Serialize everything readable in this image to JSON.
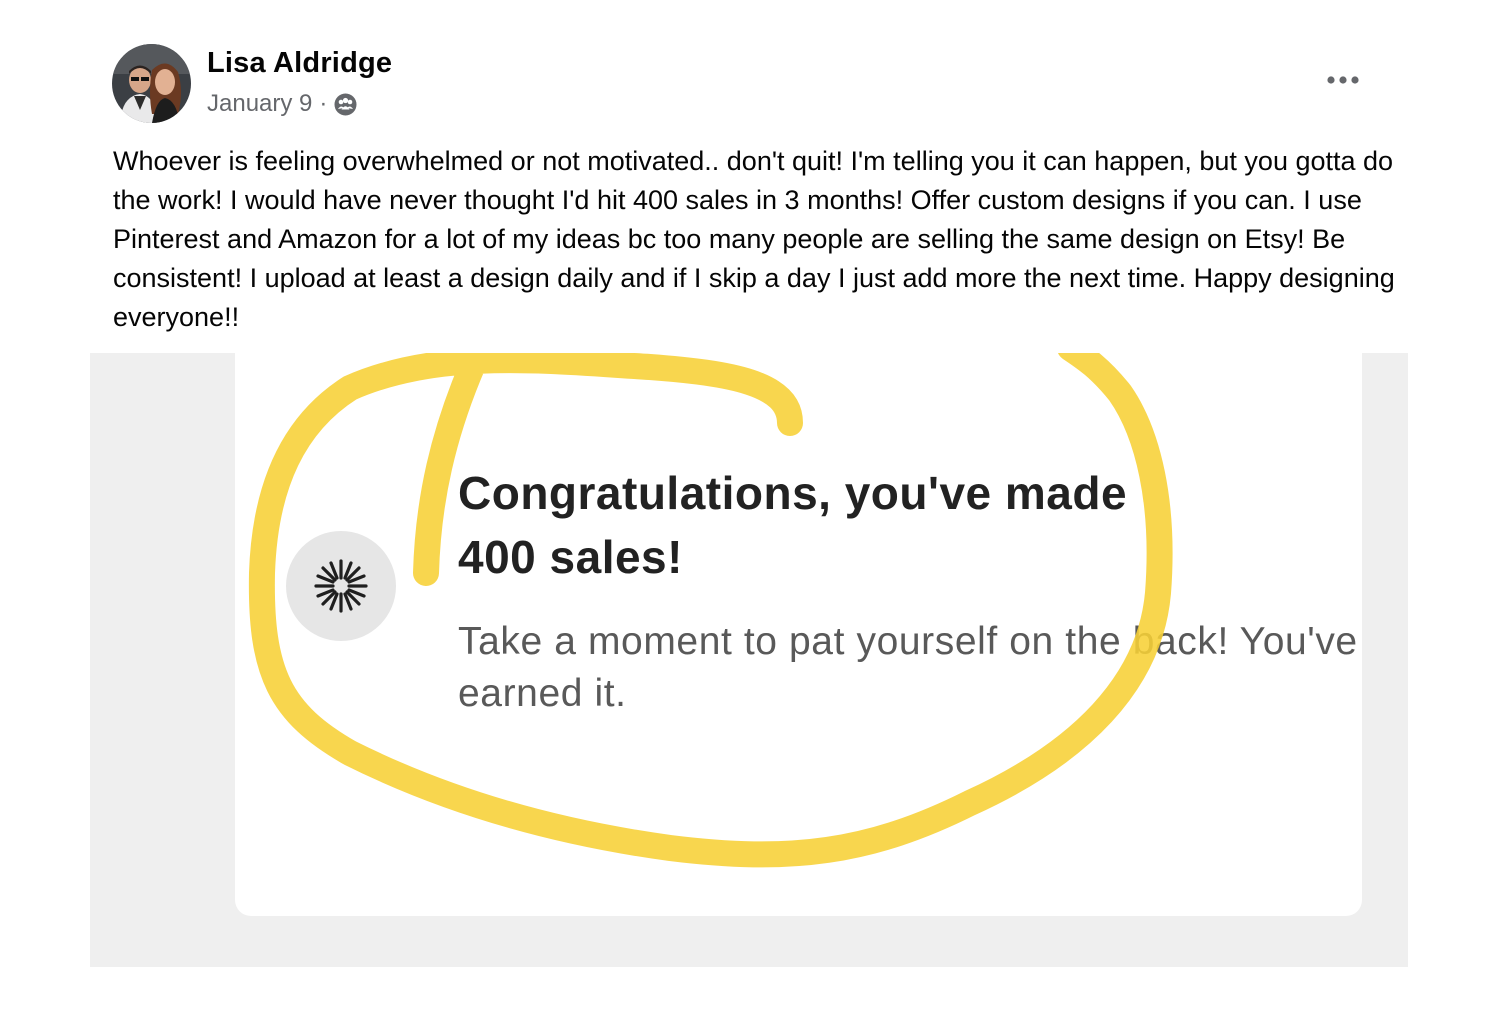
{
  "post": {
    "author": "Lisa Aldridge",
    "date": "January 9",
    "separator": "·",
    "audience_icon": "group-audience-icon",
    "more_icon": "more-options-icon",
    "text": "Whoever is feeling overwhelmed or not motivated.. don't quit! I'm telling you it can happen, but you gotta do the work! I would have never thought I'd hit 400 sales in 3 months! Offer custom designs if you can. I use Pinterest and Amazon for a lot of my ideas bc too many people are selling the same design on Etsy! Be consistent! I upload at least a design daily and if I skip a day I just add more the next time. Happy designing everyone!!"
  },
  "image": {
    "title": "Congratulations, you've made 400 sales!",
    "subtitle": "Take a moment to pat yourself on the back! You've earned it.",
    "icon": "sunburst-icon",
    "highlight_color": "#f7d035"
  }
}
